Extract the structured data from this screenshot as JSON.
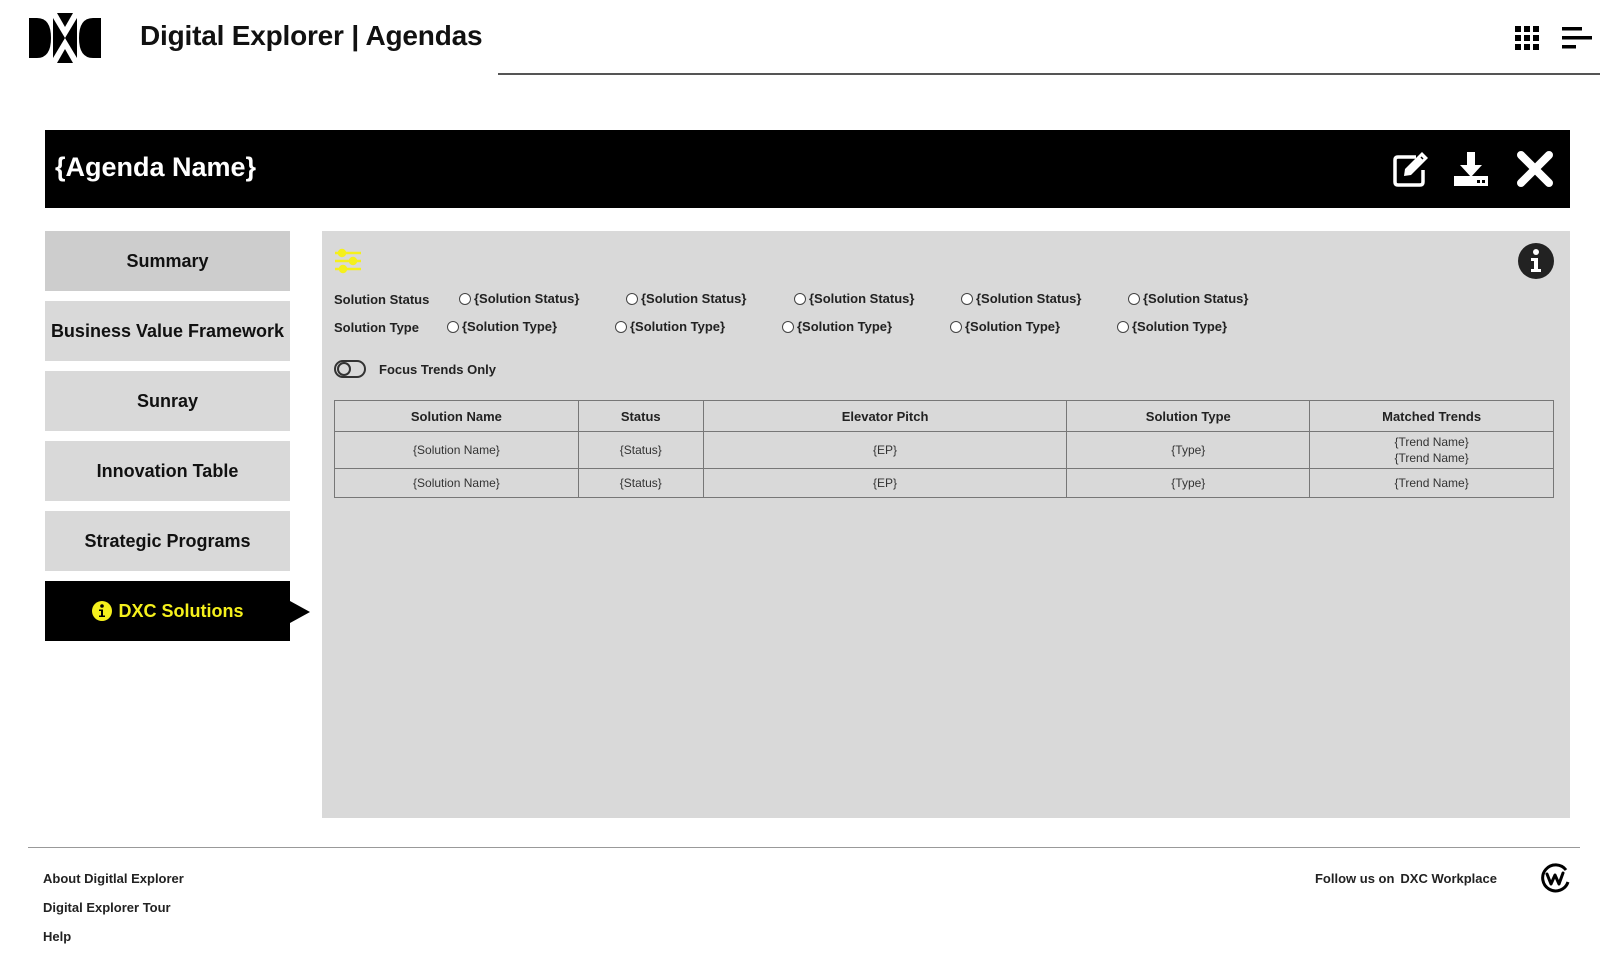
{
  "header": {
    "logo": "dxc-logo",
    "title": "Digital Explorer | Agendas",
    "icons": [
      "apps-grid-icon",
      "menu-icon"
    ]
  },
  "agenda": {
    "name": "{Agenda Name}",
    "actions": [
      "edit-icon",
      "download-icon",
      "close-icon"
    ]
  },
  "sidebar": {
    "items": [
      {
        "label": "Summary"
      },
      {
        "label": "Business Value Framework"
      },
      {
        "label": "Sunray"
      },
      {
        "label": "Innovation Table"
      },
      {
        "label": "Strategic Programs"
      },
      {
        "label": "DXC Solutions",
        "active": true,
        "icon": "info-icon"
      }
    ]
  },
  "filters": {
    "icon": "filter-sliders-icon",
    "status_label": "Solution Status",
    "status_options": [
      "{Solution Status}",
      "{Solution Status}",
      "{Solution Status}",
      "{Solution Status}",
      "{Solution Status}"
    ],
    "type_label": "Solution Type",
    "type_options": [
      "{Solution Type}",
      "{Solution Type}",
      "{Solution Type}",
      "{Solution Type}",
      "{Solution Type}"
    ],
    "toggle_label": "Focus Trends Only",
    "toggle_on": false
  },
  "table": {
    "headers": [
      "Solution Name",
      "Status",
      "Elevator Pitch",
      "Solution Type",
      "Matched Trends"
    ],
    "rows": [
      {
        "name": "{Solution Name}",
        "status": "{Status}",
        "pitch": "{EP}",
        "type": "{Type}",
        "trends": [
          "{Trend Name}",
          "{Trend Name}"
        ]
      },
      {
        "name": "{Solution Name}",
        "status": "{Status}",
        "pitch": "{EP}",
        "type": "{Type}",
        "trends": [
          "{Trend Name}"
        ]
      }
    ]
  },
  "footer": {
    "links": [
      "About Digitlal Explorer",
      "Digital Explorer Tour",
      "Help"
    ],
    "follow_text": "Follow us on",
    "follow_brand": "DXC Workplace"
  },
  "colors": {
    "accent": "#f5f01c",
    "bar_bg": "#000000",
    "panel_bg": "#d9d9d9"
  }
}
